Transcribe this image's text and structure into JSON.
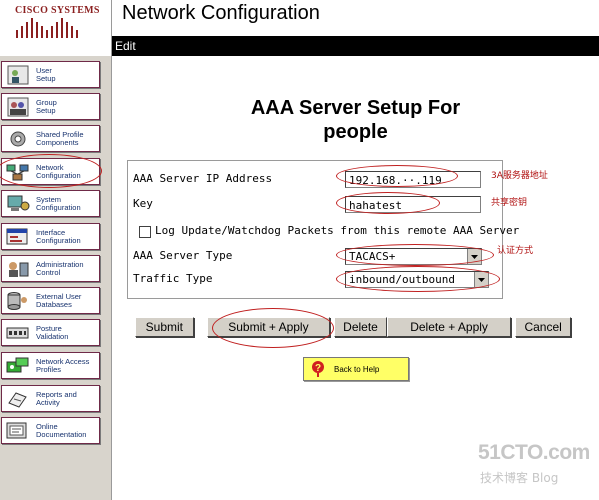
{
  "logo": {
    "text": "CISCO SYSTEMS"
  },
  "sidebar": {
    "items": [
      {
        "label": "User\nSetup",
        "icon": "user-setup-icon"
      },
      {
        "label": "Group\nSetup",
        "icon": "group-setup-icon"
      },
      {
        "label": "Shared Profile\nComponents",
        "icon": "shared-profile-icon"
      },
      {
        "label": "Network\nConfiguration",
        "icon": "network-configuration-icon"
      },
      {
        "label": "System\nConfiguration",
        "icon": "system-configuration-icon"
      },
      {
        "label": "Interface\nConfiguration",
        "icon": "interface-configuration-icon"
      },
      {
        "label": "Administration\nControl",
        "icon": "administration-control-icon"
      },
      {
        "label": "External User\nDatabases",
        "icon": "external-user-databases-icon"
      },
      {
        "label": "Posture\nValidation",
        "icon": "posture-validation-icon"
      },
      {
        "label": "Network Access\nProfiles",
        "icon": "network-access-profiles-icon"
      },
      {
        "label": "Reports and\nActivity",
        "icon": "reports-activity-icon"
      },
      {
        "label": "Online\nDocumentation",
        "icon": "online-documentation-icon"
      }
    ]
  },
  "header": {
    "title": "Network Configuration",
    "edit_label": "Edit"
  },
  "form": {
    "heading_line1": "AAA Server Setup For",
    "heading_line2": "people",
    "ip_label": "AAA Server IP Address",
    "ip_value": "192.168.··.119",
    "key_label": "Key",
    "key_value": "hahatest",
    "log_checkbox_label": "Log Update/Watchdog Packets from this remote AAA Server",
    "log_checked": false,
    "server_type_label": "AAA Server Type",
    "server_type_value": "TACACS+",
    "traffic_type_label": "Traffic Type",
    "traffic_type_value": "inbound/outbound"
  },
  "annotations": {
    "ip_note": "3A服务器地址",
    "key_note": "共享密钥",
    "type_note": "认证方式"
  },
  "buttons": {
    "submit": "Submit",
    "submit_apply": "Submit + Apply",
    "delete": "Delete",
    "delete_apply": "Delete + Apply",
    "cancel": "Cancel",
    "back_to_help": "Back to Help"
  },
  "watermark": {
    "main": "51CTO.com",
    "sub": "技术博客  Blog"
  },
  "colors": {
    "accent": "#c02020",
    "title_bar": "#000000",
    "sidebar_bg": "#d8d4cc",
    "help_button": "#ffff66"
  }
}
